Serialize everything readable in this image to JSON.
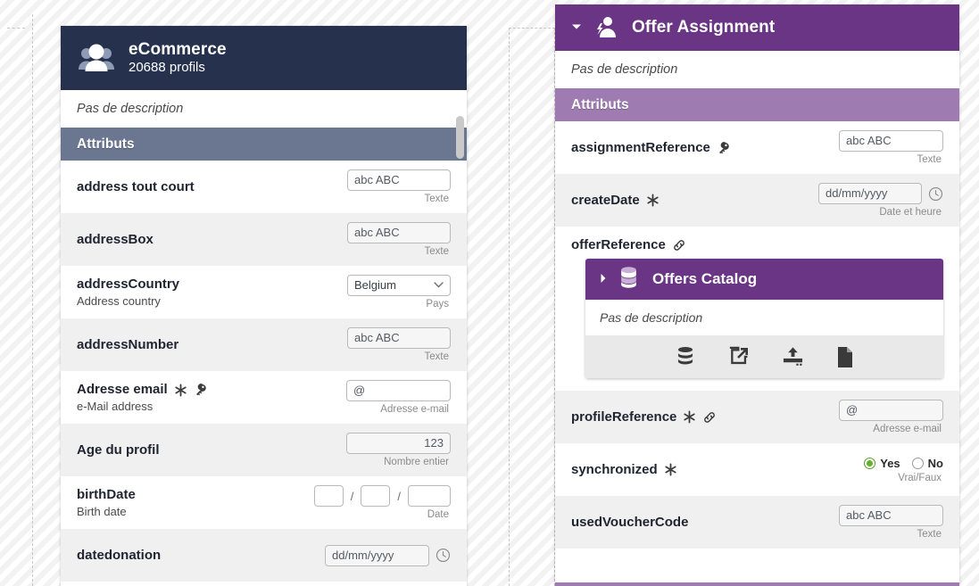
{
  "left_panel": {
    "header": {
      "icon": "users-group-icon",
      "title": "eCommerce",
      "subtitle": "20688 profils"
    },
    "description": "Pas de description",
    "section_label": "Attributs",
    "attributes": [
      {
        "name": "address tout court",
        "desc": "",
        "markers": [],
        "field": {
          "kind": "text",
          "value": "abc ABC"
        },
        "type_hint": "Texte"
      },
      {
        "name": "addressBox",
        "desc": "",
        "markers": [],
        "field": {
          "kind": "text",
          "value": "abc ABC"
        },
        "type_hint": "Texte"
      },
      {
        "name": "addressCountry",
        "desc": "Address country",
        "markers": [],
        "field": {
          "kind": "select",
          "value": "Belgium"
        },
        "type_hint": "Pays"
      },
      {
        "name": "addressNumber",
        "desc": "",
        "markers": [],
        "field": {
          "kind": "text",
          "value": "abc ABC"
        },
        "type_hint": "Texte"
      },
      {
        "name": "Adresse email",
        "desc": "e-Mail address",
        "markers": [
          "required-asterisk-icon",
          "key-icon"
        ],
        "field": {
          "kind": "text",
          "value": "@"
        },
        "type_hint": "Adresse e-mail"
      },
      {
        "name": "Age du profil",
        "desc": "",
        "markers": [],
        "field": {
          "kind": "number",
          "value": "123"
        },
        "type_hint": "Nombre entier"
      },
      {
        "name": "birthDate",
        "desc": "Birth date",
        "markers": [],
        "field": {
          "kind": "date-segments",
          "day": "",
          "month": "",
          "year": ""
        },
        "type_hint": "Date"
      },
      {
        "name": "datedonation",
        "desc": "",
        "markers": [],
        "field": {
          "kind": "datetime",
          "value": "dd/mm/yyyy"
        },
        "type_hint": ""
      }
    ],
    "scrollbar": {
      "name": "vertical-scrollbar"
    }
  },
  "right_panel": {
    "header": {
      "icon": "person-bolt-icon",
      "title": "Offer Assignment",
      "caret": "▾"
    },
    "description": "Pas de description",
    "section_label": "Attributs",
    "attributes": [
      {
        "name": "assignmentReference",
        "desc": "",
        "markers": [
          "key-icon"
        ],
        "field": {
          "kind": "text",
          "value": "abc ABC"
        },
        "type_hint": "Texte"
      },
      {
        "name": "createDate",
        "desc": "",
        "markers": [
          "required-asterisk-icon"
        ],
        "field": {
          "kind": "datetime",
          "value": "dd/mm/yyyy"
        },
        "type_hint": "Date et heure"
      },
      {
        "name": "profileReference",
        "desc": "",
        "markers": [
          "required-asterisk-icon",
          "link-icon"
        ],
        "field": {
          "kind": "text",
          "value": "@"
        },
        "type_hint": "Adresse e-mail"
      },
      {
        "name": "synchronized",
        "desc": "",
        "markers": [
          "required-asterisk-icon"
        ],
        "field": {
          "kind": "radio",
          "yes_label": "Yes",
          "no_label": "No",
          "selected": "Yes"
        },
        "type_hint": "Vrai/Faux"
      },
      {
        "name": "usedVoucherCode",
        "desc": "",
        "markers": [],
        "field": {
          "kind": "text",
          "value": "abc ABC"
        },
        "type_hint": "Texte"
      }
    ],
    "offer_reference": {
      "name": "offerReference",
      "markers": [
        "link-icon"
      ],
      "nested_card": {
        "caret": "▸",
        "icon": "database-icon",
        "title": "Offers Catalog",
        "description": "Pas de description",
        "toolbar": [
          {
            "icon": "database-icon",
            "label": "database"
          },
          {
            "icon": "external-link-icon",
            "label": "open-external"
          },
          {
            "icon": "upload-icon",
            "label": "upload"
          },
          {
            "icon": "file-icon",
            "label": "file"
          }
        ]
      }
    }
  },
  "colors": {
    "navy": "#25314d",
    "navy_section": "#6b7790",
    "purple": "#6b3585",
    "lilac_section": "#9e7cb2",
    "radio_green": "#62b12f",
    "row_alt": "#f0f0f0"
  }
}
